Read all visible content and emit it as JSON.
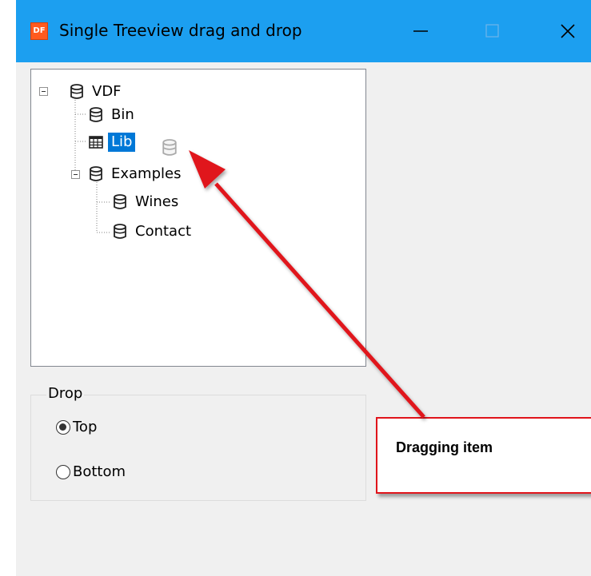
{
  "window": {
    "title": "Single Treeview drag and drop",
    "icon_text": "DF",
    "controls": {
      "minimize": "minimize-icon",
      "maximize": "maximize-icon",
      "close": "close-icon"
    },
    "title_bar_color": "#1c9ff0"
  },
  "tree": {
    "nodes": [
      {
        "label": "VDF",
        "level": 0,
        "expanded": true,
        "icon": "database-icon"
      },
      {
        "label": "Bin",
        "level": 1,
        "icon": "database-icon"
      },
      {
        "label": "Lib",
        "level": 1,
        "icon": "table-icon",
        "selected": true
      },
      {
        "label": "Examples",
        "level": 1,
        "expanded": true,
        "icon": "database-icon"
      },
      {
        "label": "Wines",
        "level": 2,
        "icon": "database-icon"
      },
      {
        "label": "Contact",
        "level": 2,
        "icon": "database-icon"
      }
    ],
    "drag_ghost_icon": "database-icon",
    "selection_color": "#0078d7"
  },
  "drop_group": {
    "legend": "Drop",
    "options": [
      {
        "label": "Top",
        "checked": true
      },
      {
        "label": "Bottom",
        "checked": false
      }
    ]
  },
  "annotation": {
    "callout_text": "Dragging item",
    "arrow_color": "#e0141b"
  }
}
